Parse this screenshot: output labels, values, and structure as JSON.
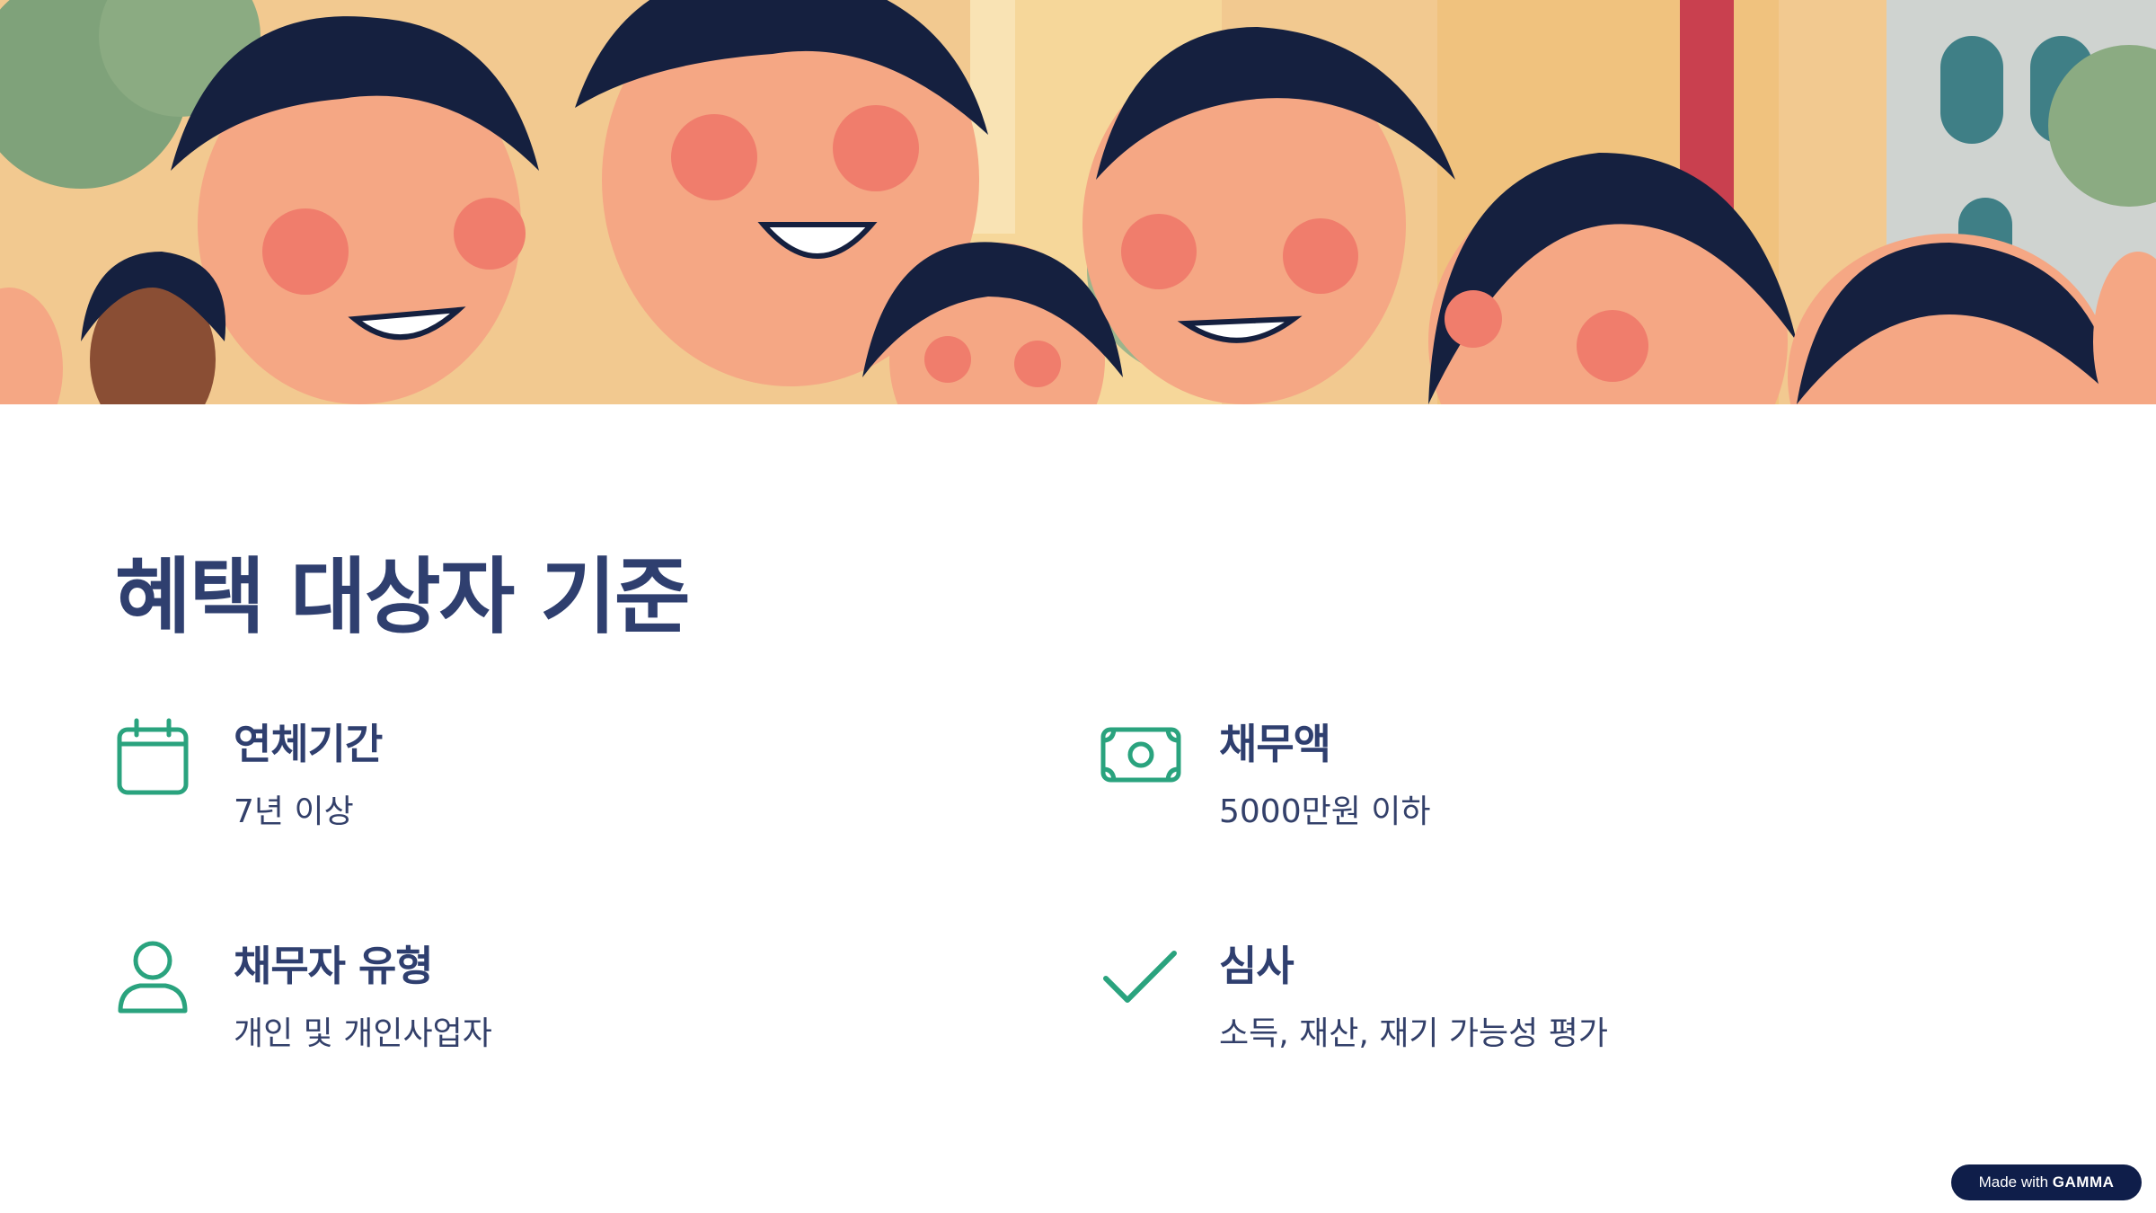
{
  "slide": {
    "title": "혜택 대상자 기준",
    "criteria": [
      {
        "id": "period",
        "icon": "calendar-icon",
        "title": "연체기간",
        "description": "7년 이상"
      },
      {
        "id": "amount",
        "icon": "money-bill-icon",
        "title": "채무액",
        "description": "5000만원 이하"
      },
      {
        "id": "type",
        "icon": "person-icon",
        "title": "채무자 유형",
        "description": "개인 및 개인사업자"
      },
      {
        "id": "review",
        "icon": "checkmark-icon",
        "title": "심사",
        "description": "소득, 재산, 재기 가능성 평가"
      }
    ]
  },
  "badge": {
    "prefix": "Made with",
    "brand": "GAMMA"
  },
  "colors": {
    "title": "#2f3f6f",
    "icon_accent": "#2aa37e",
    "badge_bg": "#0f1e4a"
  }
}
